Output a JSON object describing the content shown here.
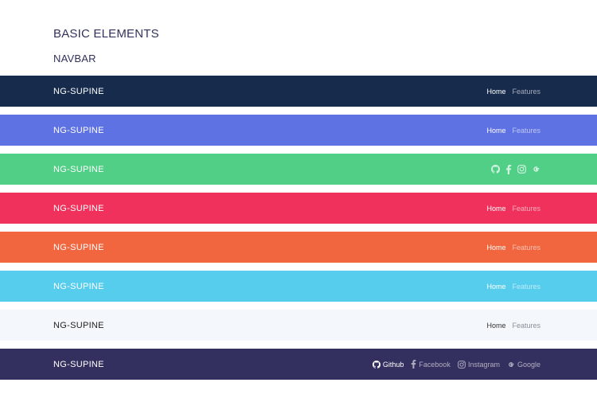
{
  "page": {
    "section_title": "BASIC ELEMENTS",
    "subsection_title": "NAVBAR"
  },
  "navbars": [
    {
      "brand": "NG-SUPINE",
      "bg": "#172b4d",
      "links": [
        "Home",
        "Features"
      ]
    },
    {
      "brand": "NG-SUPINE",
      "bg": "#5e72e4",
      "links": [
        "Home",
        "Features"
      ]
    },
    {
      "brand": "NG-SUPINE",
      "bg": "#51cf86",
      "icons": [
        "github-icon",
        "facebook-icon",
        "instagram-icon",
        "google-icon"
      ]
    },
    {
      "brand": "NG-SUPINE",
      "bg": "#f0315b",
      "links": [
        "Home",
        "Features"
      ]
    },
    {
      "brand": "NG-SUPINE",
      "bg": "#f1653f",
      "links": [
        "Home",
        "Features"
      ]
    },
    {
      "brand": "NG-SUPINE",
      "bg": "#57cdee",
      "links": [
        "Home",
        "Features"
      ]
    },
    {
      "brand": "NG-SUPINE",
      "bg": "#f4f7fb",
      "links": [
        "Home",
        "Features"
      ]
    },
    {
      "brand": "NG-SUPINE",
      "bg": "#33305f",
      "social": [
        {
          "icon": "github-icon",
          "label": "Github"
        },
        {
          "icon": "facebook-icon",
          "label": "Facebook"
        },
        {
          "icon": "instagram-icon",
          "label": "Instagram"
        },
        {
          "icon": "google-icon",
          "label": "Google"
        }
      ]
    }
  ]
}
